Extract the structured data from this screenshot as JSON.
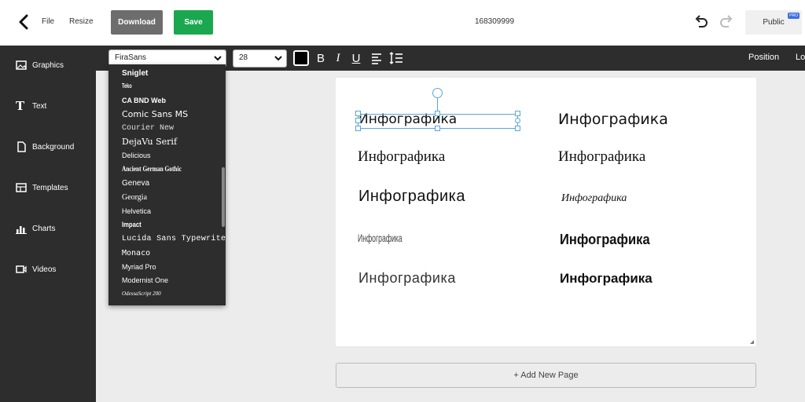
{
  "topbar": {
    "file_label": "File",
    "resize_label": "Resize",
    "download_label": "Download",
    "save_label": "Save",
    "doc_id": "168309999",
    "public_label": "Public",
    "pro_badge": "PRO",
    "colors": {
      "download_bg": "#6d6d6d",
      "save_bg": "#1aa750",
      "pro_bg": "#3d6fe0"
    }
  },
  "sidebar": {
    "items": [
      {
        "label": "Graphics",
        "icon": "image-icon"
      },
      {
        "label": "Text",
        "icon": "text-t-icon"
      },
      {
        "label": "Background",
        "icon": "background-icon"
      },
      {
        "label": "Templates",
        "icon": "templates-icon"
      },
      {
        "label": "Charts",
        "icon": "chart-icon"
      },
      {
        "label": "Videos",
        "icon": "video-icon"
      }
    ]
  },
  "toolbar": {
    "font_value": "FiraSans",
    "size_value": "28",
    "text_color": "#000000",
    "position_label": "Position",
    "lock_label": "Lo"
  },
  "font_dropdown": {
    "items": [
      "Sniglet",
      "Teko",
      "CA BND Web",
      "Comic Sans MS",
      "Courier New",
      "DejaVu Serif",
      "Delicious",
      "Ancient German Gothic",
      "Geneva",
      "Georgia",
      "Helvetica",
      "Impact",
      "Lucida Sans Typewriter",
      "Monaco",
      "Myriad Pro",
      "Modernist One",
      "OdessaScript 200"
    ]
  },
  "canvas": {
    "samples": [
      "Инфографика",
      "Инфографика",
      "Инфографика",
      "Инфографика",
      "Инфографика",
      "Инфографика",
      "Инфографика",
      "Инфографика",
      "Инфографика",
      "Инфографика"
    ]
  },
  "add_page_label": "+ Add New Page"
}
